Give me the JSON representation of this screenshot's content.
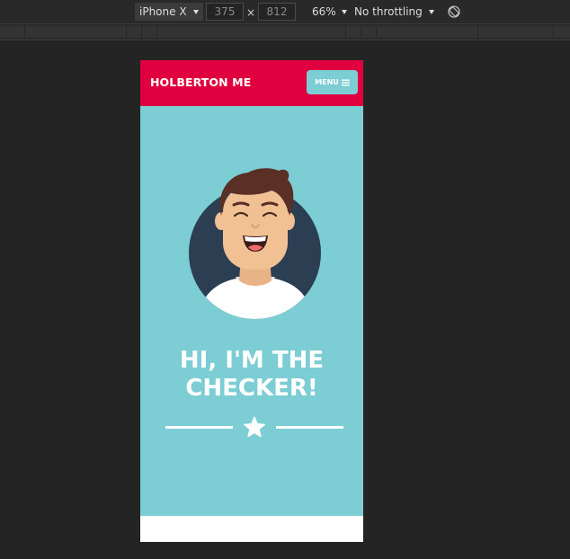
{
  "devtools": {
    "device": "iPhone X",
    "width": "375",
    "height": "812",
    "times_symbol": "×",
    "zoom": "66%",
    "throttling": "No throttling",
    "icons": {
      "caret": "caret-down-icon",
      "rotate": "rotate-icon"
    }
  },
  "site": {
    "brand": "HOLBERTON ME",
    "menu_label": "MENU",
    "menu_icon": "hamburger-icon",
    "headline_line1": "HI, I'M THE",
    "headline_line2": "CHECKER!",
    "divider_icon": "star-icon",
    "avatar_icon": "avatar-illustration",
    "colors": {
      "navbar": "#e0003f",
      "hero": "#7ccdd4",
      "menu_button": "#7ccdd4",
      "avatar_bg": "#2c3e52",
      "text": "#ffffff"
    }
  }
}
